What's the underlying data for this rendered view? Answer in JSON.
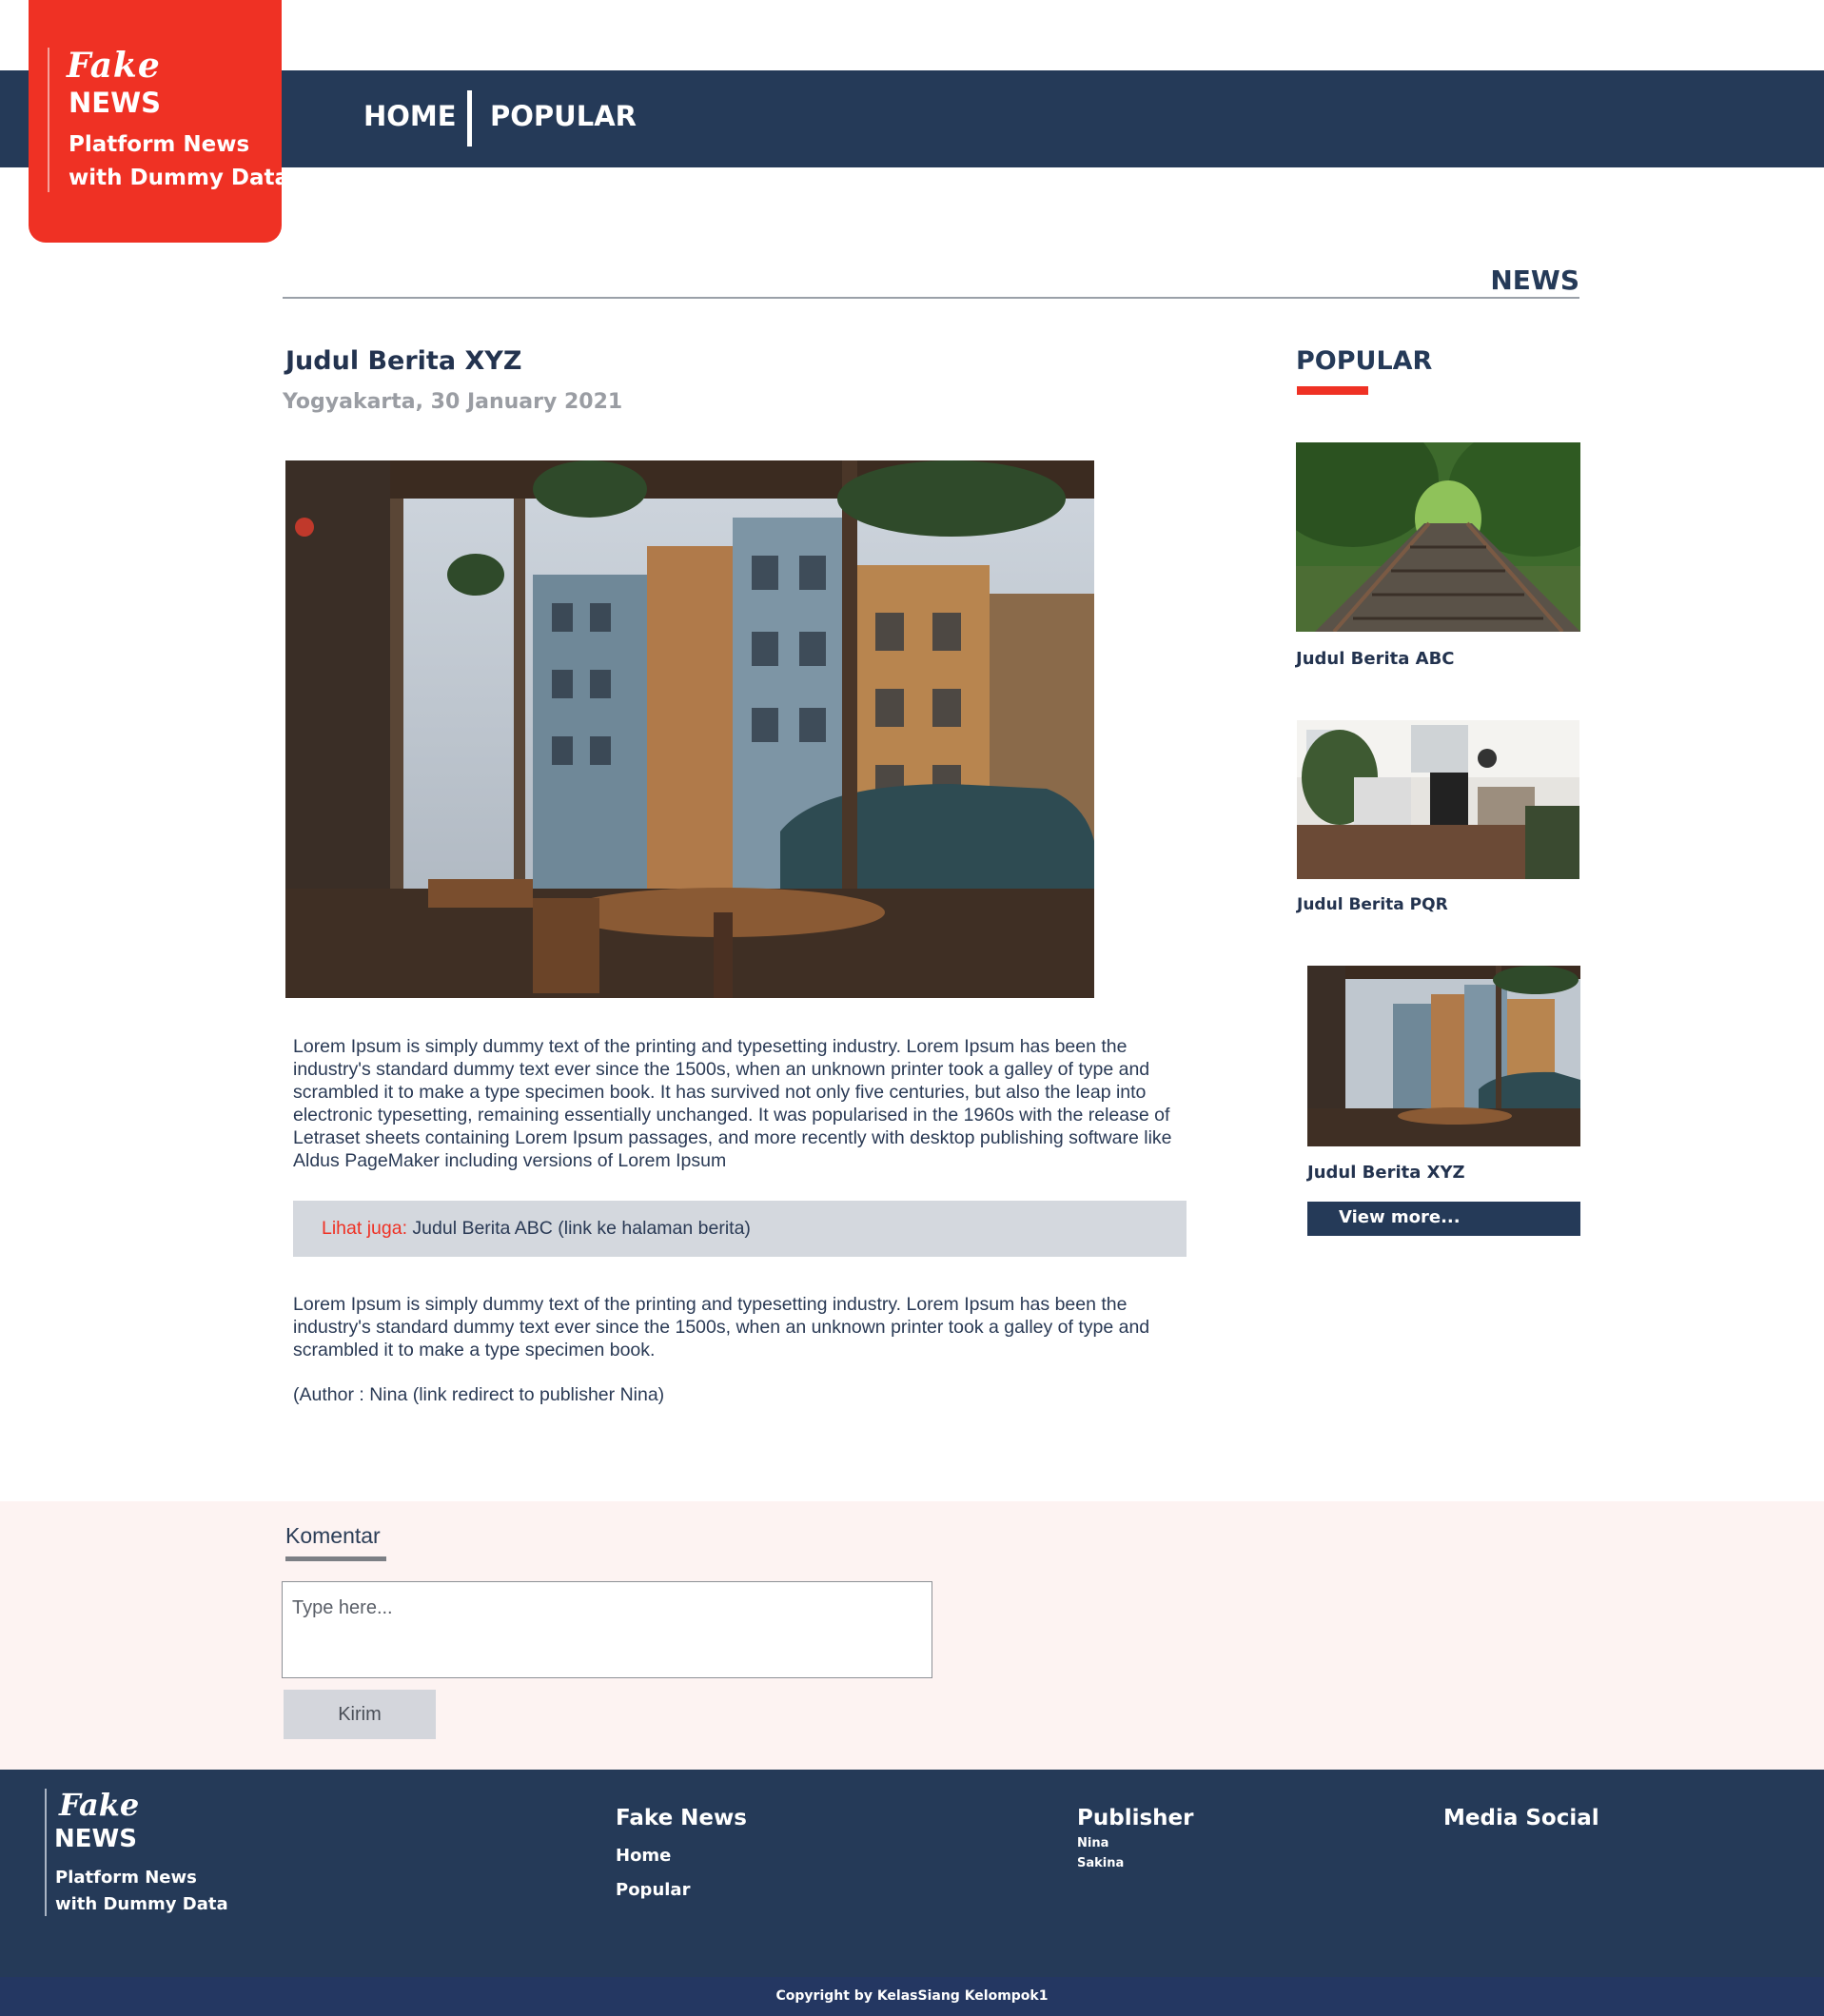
{
  "brand": {
    "logo_script": "Fake",
    "logo_word": "NEWS",
    "tagline_line1": "Platform News",
    "tagline_line2": "with Dummy Data",
    "accent_color": "#ef3124",
    "navy_color": "#253a58"
  },
  "nav": {
    "home": "HOME",
    "popular": "POPULAR"
  },
  "section_title": "NEWS",
  "article": {
    "title": "Judul Berita XYZ",
    "dateline": "Yogyakarta, 30 January 2021",
    "paragraph1": "Lorem Ipsum is simply dummy text of the printing and typesetting industry. Lorem Ipsum has been the industry's standard dummy text ever since the 1500s, when an unknown printer took a galley of type and scrambled it to make a type specimen book. It has survived not only five centuries, but also the leap into electronic typesetting, remaining essentially unchanged. It was popularised in the 1960s with the release of Letraset sheets containing Lorem Ipsum passages, and more recently with desktop publishing software like Aldus PageMaker including versions of Lorem Ipsum",
    "see_also_label": "Lihat juga:",
    "see_also_link": " Judul Berita ABC (link ke halaman berita)",
    "paragraph2": "Lorem Ipsum is simply dummy text of the printing and typesetting industry. Lorem Ipsum has been the industry's standard dummy text ever since the 1500s, when an unknown printer took a galley of type and scrambled it to make a type specimen book.",
    "author_line": "(Author : Nina (link redirect to publisher Nina)"
  },
  "popular": {
    "title": "POPULAR",
    "items": [
      {
        "title": "Judul Berita ABC"
      },
      {
        "title": "Judul Berita PQR"
      },
      {
        "title": "Judul Berita XYZ"
      }
    ],
    "view_more": "View more..."
  },
  "comments": {
    "title": "Komentar",
    "placeholder": "Type here...",
    "submit": "Kirim"
  },
  "footer": {
    "col1_title": "Fake News",
    "col1_links": [
      "Home",
      "Popular"
    ],
    "col2_title": "Publisher",
    "col2_links": [
      "Nina",
      "Sakina"
    ],
    "col3_title": "Media Social",
    "copyright": "Copyright by KelasSiang Kelompok1"
  }
}
